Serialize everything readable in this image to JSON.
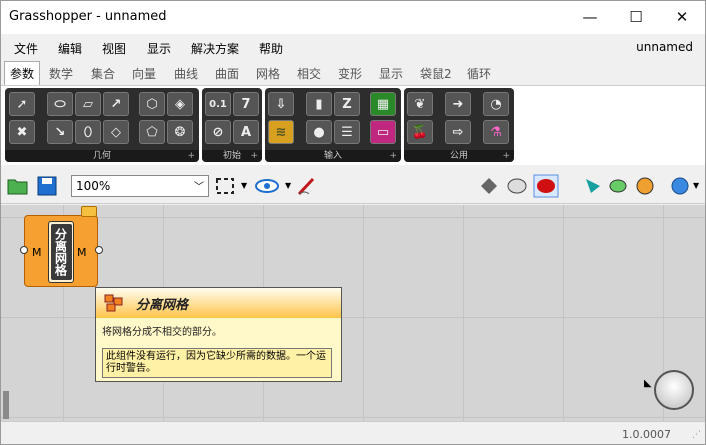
{
  "window": {
    "title": "Grasshopper - unnamed",
    "minimize": "—",
    "maximize": "☐",
    "close": "✕"
  },
  "menu": {
    "items": [
      "文件",
      "编辑",
      "视图",
      "显示",
      "解决方案",
      "帮助"
    ],
    "document": "unnamed"
  },
  "tabs": [
    "参数",
    "数学",
    "集合",
    "向量",
    "曲线",
    "曲面",
    "网格",
    "相交",
    "变形",
    "显示",
    "袋鼠2",
    "循环"
  ],
  "ribbon": {
    "panels": [
      {
        "label": "几何",
        "glyphs": [
          "➚",
          "⬭",
          "▱",
          "↗",
          "⬡",
          "◈",
          "✖",
          "↘",
          "⬯",
          "◇",
          "⬠",
          "❂"
        ]
      },
      {
        "label": "初始",
        "glyphs": [
          "0.1",
          "7",
          "⊘",
          "A"
        ]
      },
      {
        "label": "输入",
        "glyphs": [
          "⇩",
          "▮",
          "Z",
          "▦",
          "≋",
          "●",
          "☰",
          "▭"
        ]
      },
      {
        "label": "公用",
        "glyphs": [
          "❦",
          "➜",
          "◔",
          "🍒",
          "⇨",
          "⚗"
        ]
      }
    ]
  },
  "toolbar": {
    "zoom": "100%"
  },
  "component": {
    "name": "分离网格",
    "input": "M",
    "output": "M"
  },
  "tooltip": {
    "title": "分离网格",
    "description": "将网格分成不相交的部分。",
    "warning": "此组件没有运行，因为它缺少所需的数据。一个运行时警告。"
  },
  "status": {
    "version": "1.0.0007"
  }
}
